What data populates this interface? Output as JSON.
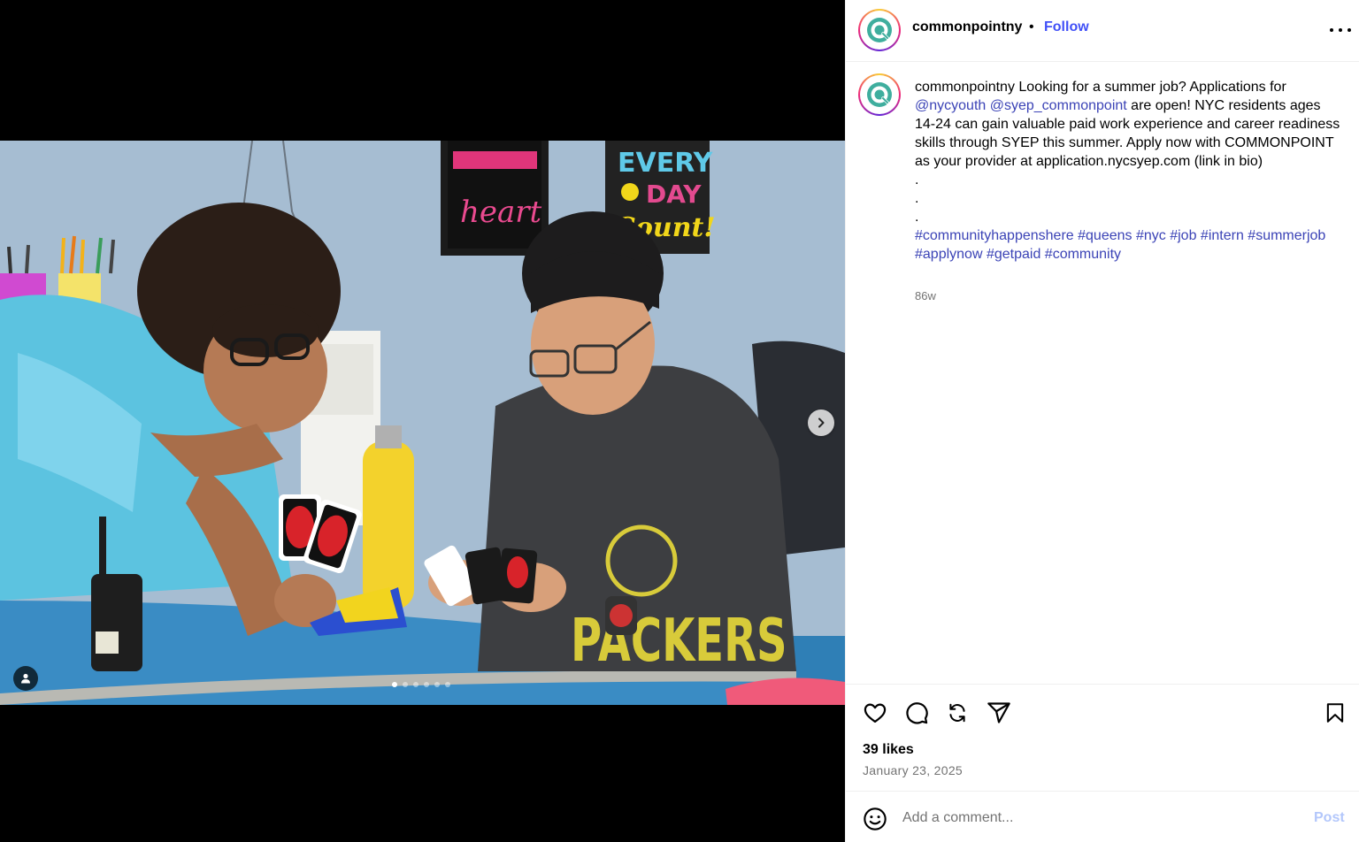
{
  "post": {
    "username": "commonpointny",
    "separator": "•",
    "follow_label": "Follow",
    "caption": {
      "username": "commonpointny",
      "text_1": " Looking for a summer job? Applications for ",
      "mention_1": "@nycyouth",
      "space": " ",
      "mention_2": "@syep_commonpoint",
      "text_2": " are open! NYC residents ages 14-24 can gain valuable paid work experience and career readiness skills through SYEP this summer. Apply now with COMMONPOINT as your provider at application.nycsyep.com (link in bio)",
      "dot_1": ".",
      "dot_2": ".",
      "dot_3": ".",
      "hashtags": [
        "#communityhappenshere",
        "#queens",
        "#nyc",
        "#job",
        "#intern",
        "#summerjob",
        "#applynow",
        "#getpaid",
        "#community"
      ]
    },
    "age": "86w",
    "likes": "39 likes",
    "date": "January 23, 2025"
  },
  "carousel": {
    "total_slides": 6,
    "active_index": 0
  },
  "comment": {
    "placeholder": "Add a comment...",
    "post_label": "Post"
  },
  "colors": {
    "link": "#3b43b6",
    "follow": "#4150f7",
    "post_disabled": "#b3c7fb",
    "muted": "#737373",
    "brand_teal": "#3fae9e"
  },
  "icons": {
    "next": "chevron-right-icon",
    "tag": "person-icon",
    "like": "heart-icon",
    "comment": "comment-icon",
    "repost": "repost-icon",
    "share": "send-icon",
    "save": "bookmark-icon",
    "emoji": "emoji-icon",
    "more": "more-options-icon"
  }
}
